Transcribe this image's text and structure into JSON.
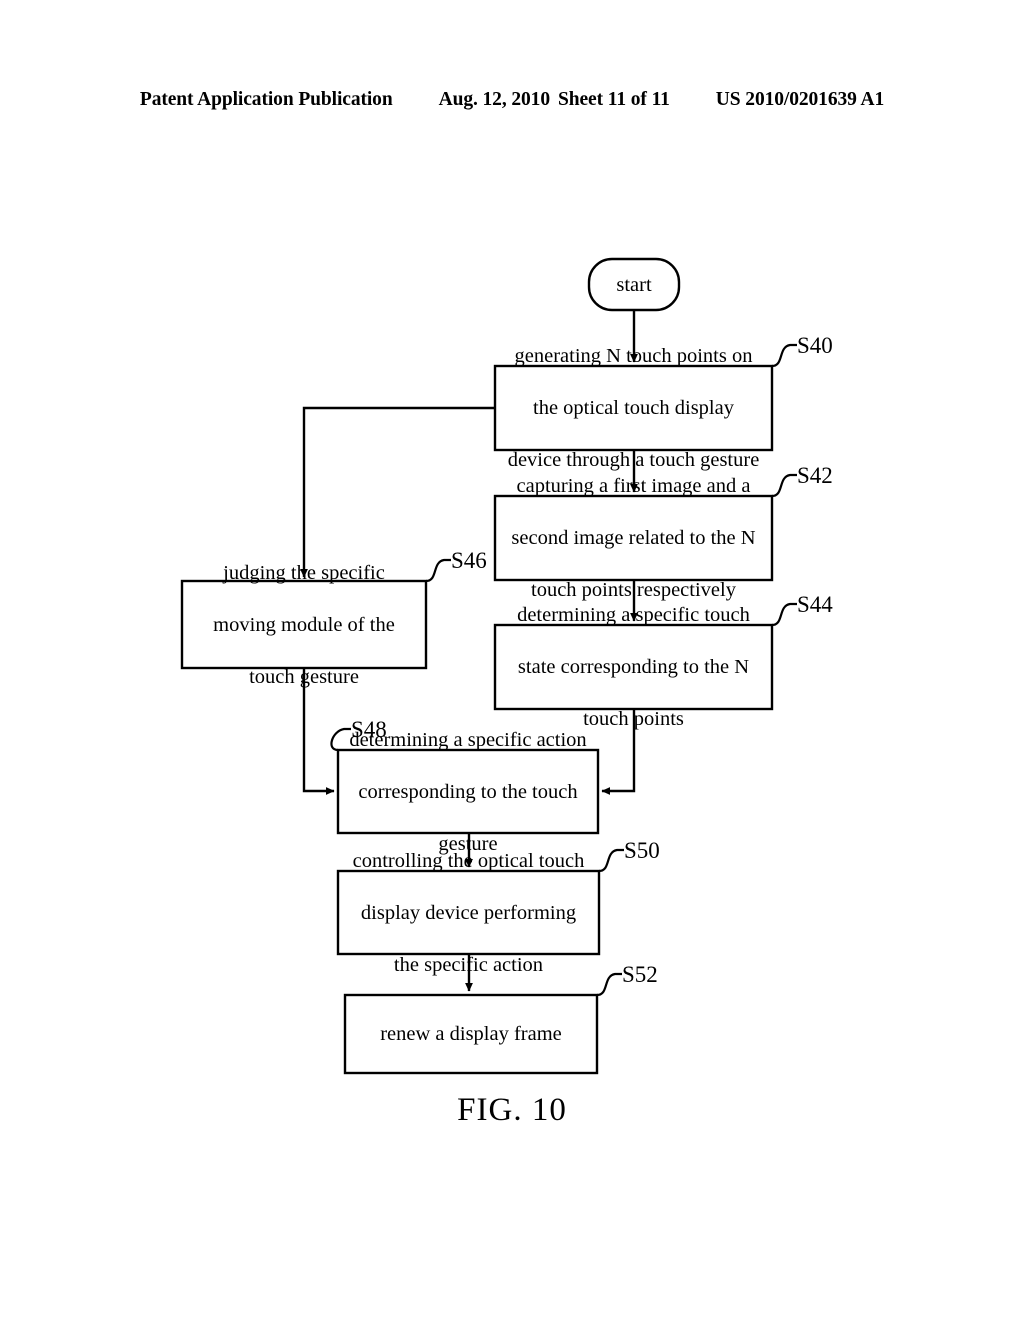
{
  "header": {
    "publication": "Patent Application Publication",
    "date": "Aug. 12, 2010",
    "sheet": "Sheet 11 of 11",
    "patent_number": "US 2010/0201639 A1"
  },
  "figure": {
    "caption": "FIG. 10",
    "start_node": "start",
    "nodes": [
      {
        "id": "S40",
        "label": "S40",
        "lines": [
          "generating N touch points on",
          "the optical touch display",
          "device through a touch gesture"
        ]
      },
      {
        "id": "S42",
        "label": "S42",
        "lines": [
          "capturing a first image and a",
          "second image related to the N",
          "touch points respectively"
        ]
      },
      {
        "id": "S44",
        "label": "S44",
        "lines": [
          "determining a specific touch",
          "state corresponding to the N",
          "touch points"
        ]
      },
      {
        "id": "S46",
        "label": "S46",
        "lines": [
          "judging the specific",
          "moving module of the",
          "touch gesture"
        ]
      },
      {
        "id": "S48",
        "label": "S48",
        "lines": [
          "determining a specific action",
          "corresponding to the touch",
          "gesture"
        ]
      },
      {
        "id": "S50",
        "label": "S50",
        "lines": [
          "controlling the optical touch",
          "display device performing",
          "the specific action"
        ]
      },
      {
        "id": "S52",
        "label": "S52",
        "lines": [
          "renew a display frame"
        ]
      }
    ]
  },
  "style": {
    "line_color": "#000000",
    "background": "#ffffff"
  }
}
